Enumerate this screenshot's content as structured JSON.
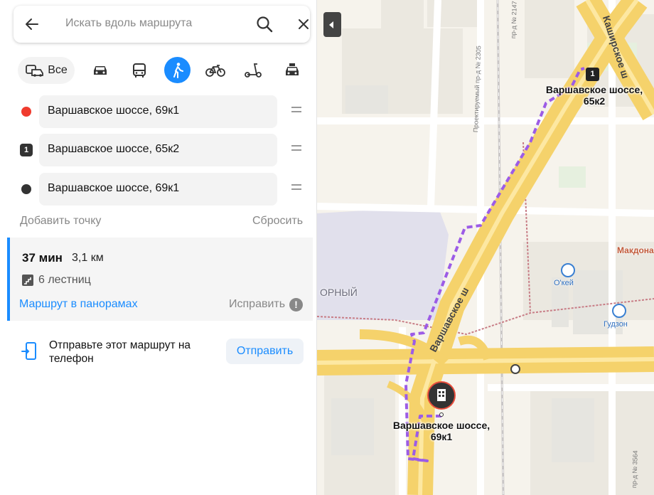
{
  "search": {
    "placeholder": "Искать вдоль маршрута"
  },
  "transport_modes": {
    "all_label": "Все",
    "modes": [
      "car-icon",
      "bus-icon",
      "pedestrian-icon",
      "bicycle-icon",
      "scooter-icon",
      "taxi-icon"
    ],
    "active": "pedestrian-icon"
  },
  "points": [
    {
      "marker": "red-dot",
      "color": "#f03b2e",
      "address": "Варшавское шоссе, 69к1"
    },
    {
      "marker": "number",
      "number": "1",
      "address": "Варшавское шоссе, 65к2"
    },
    {
      "marker": "black-dot",
      "color": "#333333",
      "address": "Варшавское шоссе, 69к1"
    }
  ],
  "actions": {
    "add_point": "Добавить точку",
    "reset": "Сбросить"
  },
  "route": {
    "time": "37 мин",
    "distance": "3,1 км",
    "stairs": "6 лестниц",
    "panorama_link": "Маршрут в панорамах",
    "fix_link": "Исправить",
    "fix_icon": "!"
  },
  "send": {
    "text": "Отправьте этот маршрут на телефон",
    "button": "Отправить"
  },
  "map": {
    "route_color": "#9c5ce6",
    "accent": "#1a8cff",
    "labels": {
      "waypoint_1": "Варшавское шоссе,\n65к2",
      "start": "Варшавское шоссе,\n69к1",
      "waypoint_number": "1"
    },
    "streets": {
      "varshavskoe": "Варшавское ш",
      "kashirskoe": "Каширское ш",
      "proezd_2305": "Проектируемый пр-д № 2305",
      "proezd_2147": "пр-д № 2147",
      "proezd_3564": "пр-д № 3564"
    },
    "pois": {
      "okey": "О'кей",
      "gudzon": "Гудзон",
      "mcdonalds": "Макдона",
      "district": "ОРНЫЙ"
    }
  }
}
